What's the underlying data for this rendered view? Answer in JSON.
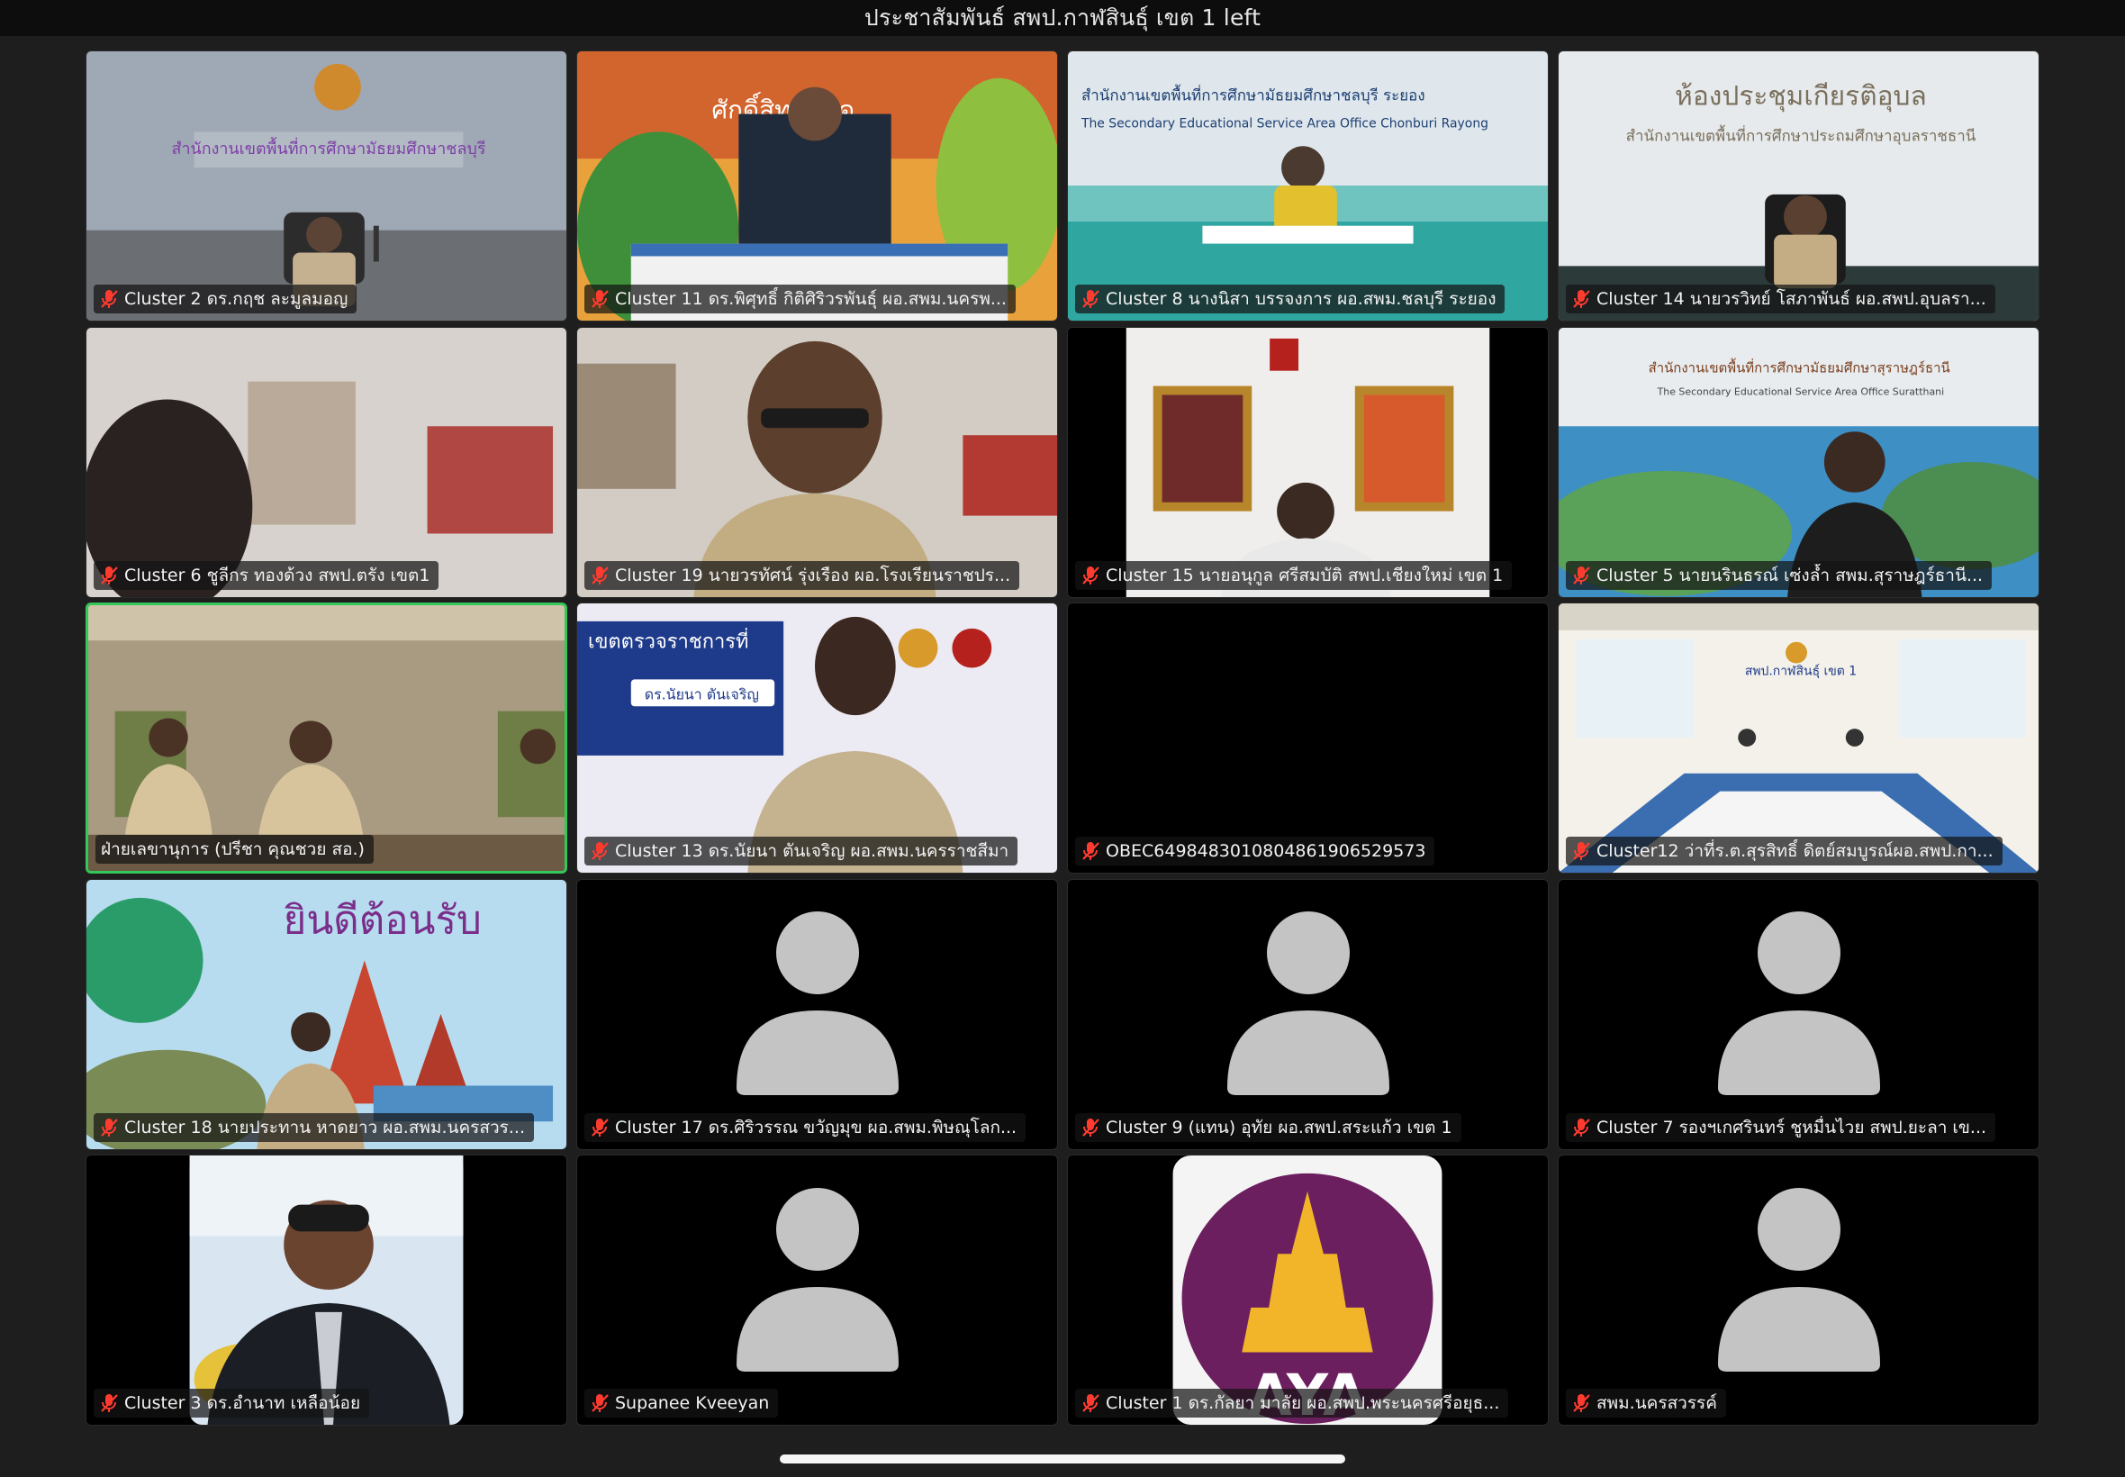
{
  "window": {
    "title": "ประชาสัมพันธ์ สพป.กาฬสินธุ์ เขต 1 left"
  },
  "icons": {
    "muted": "mic-muted-icon",
    "avatar": "person-placeholder-icon"
  },
  "colors": {
    "active_speaker_border": "#34c759",
    "muted_icon": "#ff3b30",
    "background": "#1e1e1e"
  },
  "tiles": [
    {
      "name": "Cluster 2 ดร.กฤช ละมูลมอญ",
      "muted": true,
      "video": true
    },
    {
      "name": "Cluster 11 ดร.พิศุทธิ์ กิติศิริวรพันธุ์ ผอ.สพม.นครพ...",
      "muted": true,
      "video": true
    },
    {
      "name": "Cluster 8 นางนิสา บรรจงการ ผอ.สพม.ชลบุรี ระยอง",
      "muted": true,
      "video": true
    },
    {
      "name": "Cluster 14 นายวรวิทย์ โสภาพันธ์ ผอ.สพป.อุบลรา...",
      "muted": true,
      "video": true
    },
    {
      "name": "Cluster 6 ชูลีกร  ทองด้วง สพป.ตรัง เขต1",
      "muted": true,
      "video": true
    },
    {
      "name": "Cluster 19 นายวรทัศน์ รุ่งเรือง ผอ.โรงเรียนราชปร...",
      "muted": true,
      "video": true
    },
    {
      "name": "Cluster 15 นายอนุกูล ศรีสมบัติ สพป.เชียงใหม่ เขต 1",
      "muted": true,
      "video": true
    },
    {
      "name": "Cluster 5 นายนรินธรณ์  เซ่งล้ำ สพม.สุราษฎร์ธานี...",
      "muted": true,
      "video": true
    },
    {
      "name": "ฝ่ายเลขานุการ (ปรีชา คุณชวย สอ.)",
      "muted": false,
      "video": true,
      "active": true
    },
    {
      "name": "Cluster 13 ดร.นัยนา ตันเจริญ ผอ.สพม.นครราชสีมา",
      "muted": true,
      "video": true
    },
    {
      "name": "OBEC6498483010804861906529573",
      "muted": true,
      "video": false
    },
    {
      "name": "Cluster12 ว่าที่ร.ต.สุรสิทธิ์ ดิตย์สมบูรณ์ผอ.สพป.กา...",
      "muted": true,
      "video": true
    },
    {
      "name": "Cluster 18 นายประทาน หาดยาว ผอ.สพม.นครสวร...",
      "muted": true,
      "video": true
    },
    {
      "name": "Cluster 17 ดร.ศิริวรรณ ขวัญมุข ผอ.สพม.พิษณุโลก...",
      "muted": true,
      "video": false,
      "avatar": true
    },
    {
      "name": "Cluster 9 (แทน) อุทัย ผอ.สพป.สระแก้ว เขต 1",
      "muted": true,
      "video": false,
      "avatar": true
    },
    {
      "name": "Cluster 7 รองฯเกศรินทร์  ชูหมื่นไวย สพป.ยะลา เข...",
      "muted": true,
      "video": false,
      "avatar": true
    },
    {
      "name": "Cluster 3 ดร.อำนาท เหลือน้อย",
      "muted": true,
      "video": true
    },
    {
      "name": "Supanee Kveeyan",
      "muted": true,
      "video": false,
      "avatar": true
    },
    {
      "name": "Cluster 1 ดร.กัลยา มาลัย ผอ.สพป.พระนครศรีอยุธ...",
      "muted": true,
      "video": true
    },
    {
      "name": "สพม.นครสวรรค์",
      "muted": true,
      "video": false,
      "avatar": true
    }
  ],
  "backgrounds": {
    "t0": "สำนักงานเขตพื้นที่การศึกษามัธยมศึกษาชลบุรี",
    "t1": "ศักดิ์สิทธิ์ที่สุด",
    "t2a": "สำนักงานเขตพื้นที่การศึกษามัธยมศึกษาชลบุรี ระยอง",
    "t2b": "The Secondary Educational Service Area Office Chonburi Rayong",
    "t3a": "ห้องประชุมเกียรติอุบล",
    "t3b": "สำนักงานเขตพื้นที่การศึกษาประถมศึกษาอุบลราชธานี",
    "t7a": "สำนักงานเขตพื้นที่การศึกษามัธยมศึกษาสุราษฎร์ธานี",
    "t7b": "The Secondary Educational Service Area Office Suratthani",
    "t9a": "เขตตรวจราชการที่",
    "t9b": "ดร.นัยนา ตันเจริญ",
    "t11": "สพป.กาฬสินธุ์ เขต 1",
    "t12": "ยินดีต้อนรับ",
    "t18": "AYA"
  }
}
